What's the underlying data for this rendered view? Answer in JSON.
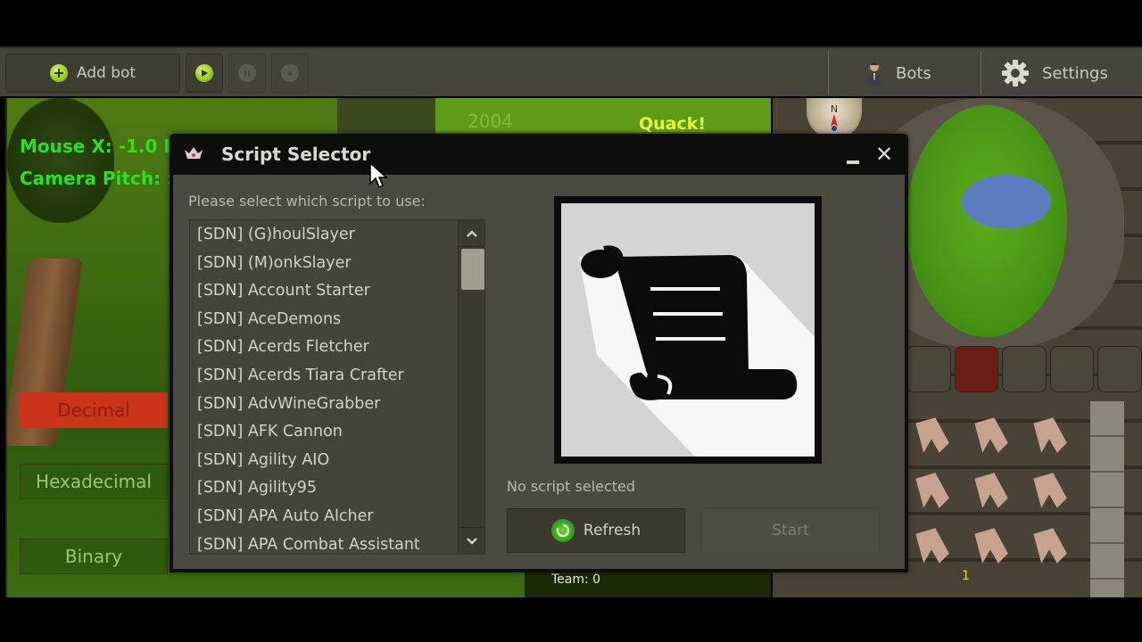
{
  "toolbar": {
    "add_bot_label": "Add bot",
    "bots_label": "Bots",
    "settings_label": "Settings",
    "icons": {
      "add": "plus-circle-icon",
      "play": "play-icon",
      "pause": "pause-icon",
      "stop": "stop-icon",
      "bots": "user-icon",
      "settings": "gear-icon"
    }
  },
  "game": {
    "mouse_text": "Mouse X: -1.0 I",
    "camera_text": "Camera Pitch: :",
    "year_text": "2004",
    "chat_bubble": "Quack!",
    "modes": [
      "Decimal",
      "Hexadecimal",
      "Binary"
    ],
    "active_mode": "Decimal",
    "team_text": "Team: 0",
    "inventory_count": "1"
  },
  "dialog": {
    "title": "Script Selector",
    "prompt": "Please select which script to use:",
    "scripts": [
      "[SDN] (G)houlSlayer",
      "[SDN] (M)onkSlayer",
      "[SDN] Account Starter",
      "[SDN] AceDemons",
      "[SDN] Acerds Fletcher",
      "[SDN] Acerds Tiara Crafter",
      "[SDN] AdvWineGrabber",
      "[SDN] AFK Cannon",
      "[SDN] Agility AIO",
      "[SDN] Agility95",
      "[SDN] APA Auto Alcher",
      "[SDN] APA Combat Assistant"
    ],
    "status": "No script selected",
    "refresh_label": "Refresh",
    "start_label": "Start",
    "minimize_glyph": "▬",
    "close_glyph": "✕",
    "scroll_up_glyph": "⌃",
    "scroll_down_glyph": "⌄",
    "preview_icon": "scroll-icon"
  },
  "colors": {
    "accent_green": "#9bcb1f",
    "refresh_green": "#2f9a14",
    "overlay_green": "#29e023",
    "decimal_red": "#c9331a"
  }
}
